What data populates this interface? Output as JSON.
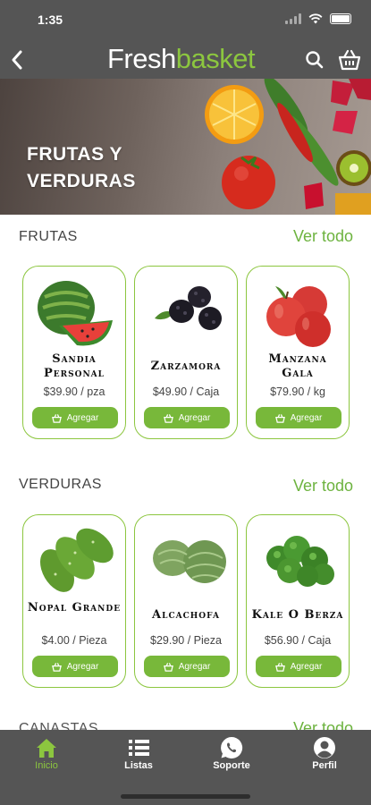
{
  "status": {
    "time": "1:35"
  },
  "header": {
    "logo_part1": "Fresh",
    "logo_part2": "basket",
    "icons": [
      "back-icon",
      "search-icon",
      "basket-icon"
    ]
  },
  "hero": {
    "line1": "FRUTAS Y",
    "line2": "VERDURAS"
  },
  "sections": [
    {
      "title": "FRUTAS",
      "see_all": "Ver todo",
      "products": [
        {
          "name": "Sandia Personal",
          "price": "$39.90 / pza",
          "button": "Agregar"
        },
        {
          "name": "Zarzamora",
          "price": "$49.90 / Caja",
          "button": "Agregar"
        },
        {
          "name": "Manzana Gala",
          "price": "$79.90 / kg",
          "button": "Agregar"
        }
      ]
    },
    {
      "title": "VERDURAS",
      "see_all": "Ver todo",
      "products": [
        {
          "name": "Nopal Grande",
          "price": "$4.00 / Pieza",
          "button": "Agregar"
        },
        {
          "name": "Alcachofa",
          "price": "$29.90 / Pieza",
          "button": "Agregar"
        },
        {
          "name": "Kale o Berza",
          "price": "$56.90 / Caja",
          "button": "Agregar"
        }
      ]
    },
    {
      "title": "CANASTAS",
      "see_all": "Ver todo"
    }
  ],
  "tabbar": {
    "tabs": [
      {
        "label": "Inicio",
        "icon": "home-icon",
        "active": true
      },
      {
        "label": "Listas",
        "icon": "list-icon",
        "active": false
      },
      {
        "label": "Soporte",
        "icon": "whatsapp-icon",
        "active": false
      },
      {
        "label": "Perfil",
        "icon": "user-icon",
        "active": false
      }
    ]
  },
  "colors": {
    "bar": "#555555",
    "accent": "#8cc63f",
    "button": "#78b83a"
  }
}
